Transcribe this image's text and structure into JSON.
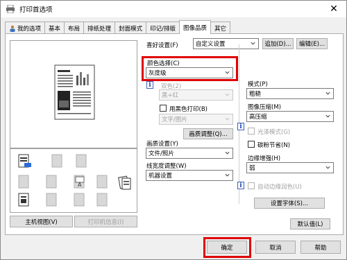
{
  "window": {
    "title": "打印首选项",
    "close_glyph": "✕"
  },
  "tabs": [
    {
      "label": "我的选项",
      "active": false
    },
    {
      "label": "基本",
      "active": false
    },
    {
      "label": "布局",
      "active": false
    },
    {
      "label": "排纸处理",
      "active": false
    },
    {
      "label": "封面模式",
      "active": false
    },
    {
      "label": "印记/排版",
      "active": false
    },
    {
      "label": "图像品质",
      "active": true
    },
    {
      "label": "其它",
      "active": false
    }
  ],
  "favorites": {
    "label": "喜好设置(F)",
    "value": "自定义设置",
    "add_button": "追加(D)...",
    "edit_button": "编辑(E)..."
  },
  "color_select": {
    "label": "颜色选择(C)",
    "value": "灰度级"
  },
  "dual_color": {
    "label": "双色(2)",
    "value": "黑+红"
  },
  "black_print": {
    "label": "用黑色打印(B)",
    "value": "文字/图片"
  },
  "quality_adjust_button": "画质调整(Q)...",
  "image_settings": {
    "label": "画质设置(Y)",
    "value": "文件/照片"
  },
  "line_width": {
    "label": "线宽度调整(W)",
    "value": "机器设置"
  },
  "mode": {
    "label": "模式(P)",
    "value": "粗糙"
  },
  "compression": {
    "label": "图像压缩(M)",
    "value": "高压缩"
  },
  "gloss_mode": {
    "label": "光泽模式(G)"
  },
  "toner_save": {
    "label": "碳粉节省(N)"
  },
  "edge_enhance": {
    "label": "边缘增强(H)",
    "value": "弱"
  },
  "auto_trap": {
    "label": "自动边缘润色(U)"
  },
  "font_settings_button": "设置字体(S)...",
  "default_button": "默认值(L)",
  "left_buttons": {
    "main_view": "主机视图(V)",
    "printer_info": "打印机信息(I)"
  },
  "footer": {
    "ok": "确定",
    "cancel": "取消",
    "help": "帮助"
  },
  "colors": {
    "highlight": "#e00000",
    "info_icon": "#1d43b5"
  }
}
